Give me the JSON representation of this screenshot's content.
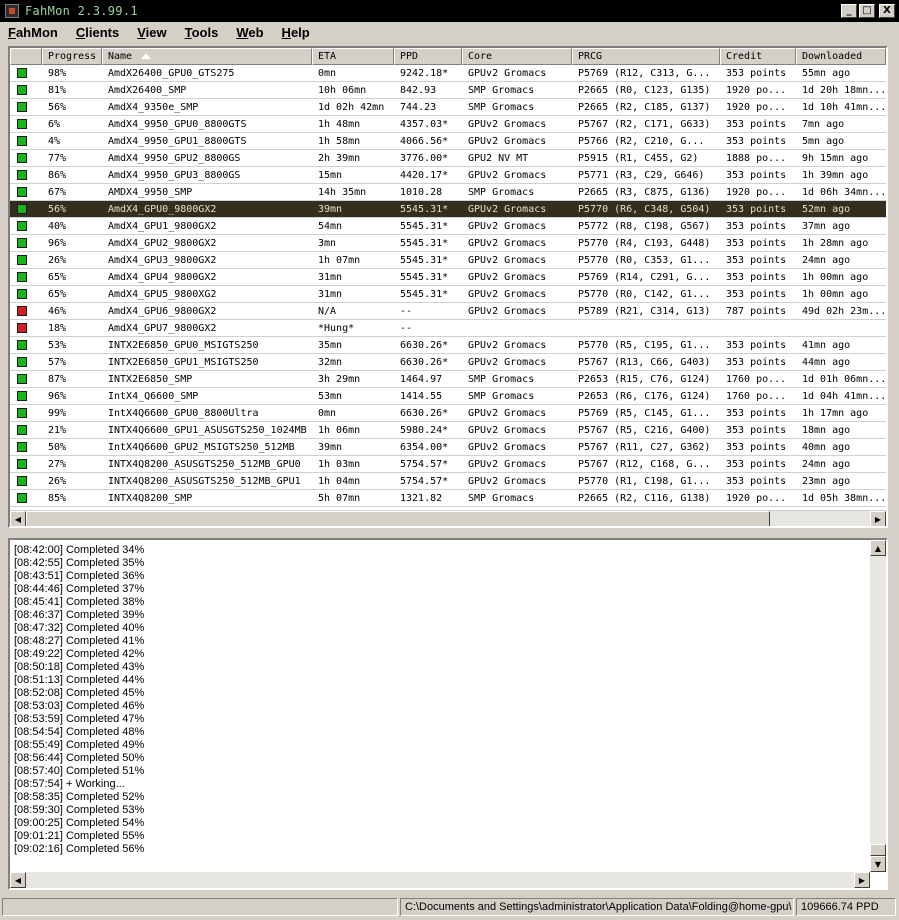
{
  "window": {
    "title": "FahMon 2.3.99.1"
  },
  "window_controls": {
    "minimize": "_",
    "maximize": "□",
    "close": "X"
  },
  "menu": {
    "fahmon": {
      "u": "F",
      "rest": "ahMon"
    },
    "clients": {
      "u": "C",
      "rest": "lients"
    },
    "view": {
      "u": "V",
      "rest": "iew"
    },
    "tools": {
      "u": "T",
      "rest": "ools"
    },
    "web": {
      "u": "W",
      "rest": "eb"
    },
    "help": {
      "u": "H",
      "rest": "elp"
    }
  },
  "columns": {
    "progress": "Progress",
    "name": "Name",
    "eta": "ETA",
    "ppd": "PPD",
    "core": "Core",
    "prcg": "PRCG",
    "credit": "Credit",
    "downloaded": "Downloaded"
  },
  "colors": {
    "ok": "#18b418",
    "stopped": "#d42020",
    "selected_bg": "#332e1e"
  },
  "rows": [
    {
      "status": "ok",
      "progress": "98%",
      "name": "AmdX26400_GPU0_GTS275",
      "eta": "0mn",
      "ppd": "9242.18*",
      "core": "GPUv2 Gromacs",
      "prcg": "P5769 (R12, C313, G...",
      "credit": "353 points",
      "downloaded": "55mn ago"
    },
    {
      "status": "ok",
      "progress": "81%",
      "name": "AmdX26400_SMP",
      "eta": "10h 06mn",
      "ppd": "842.93",
      "core": "SMP Gromacs",
      "prcg": "P2665 (R0, C123, G135)",
      "credit": "1920 po...",
      "downloaded": "1d 20h 18mn..."
    },
    {
      "status": "ok",
      "progress": "56%",
      "name": "AmdX4_9350e_SMP",
      "eta": "1d 02h 42mn",
      "ppd": "744.23",
      "core": "SMP Gromacs",
      "prcg": "P2665 (R2, C185, G137)",
      "credit": "1920 po...",
      "downloaded": "1d 10h 41mn..."
    },
    {
      "status": "ok",
      "progress": "6%",
      "name": "AmdX4_9950_GPU0_8800GTS",
      "eta": "1h 48mn",
      "ppd": "4357.03*",
      "core": "GPUv2 Gromacs",
      "prcg": "P5767 (R2, C171, G633)",
      "credit": "353 points",
      "downloaded": "7mn ago"
    },
    {
      "status": "ok",
      "progress": "4%",
      "name": "AmdX4_9950_GPU1_8800GTS",
      "eta": "1h 58mn",
      "ppd": "4066.56*",
      "core": "GPUv2 Gromacs",
      "prcg": "P5766 (R2, C210, G...",
      "credit": "353 points",
      "downloaded": "5mn ago"
    },
    {
      "status": "ok",
      "progress": "77%",
      "name": "AmdX4_9950_GPU2_8800GS",
      "eta": "2h 39mn",
      "ppd": "3776.00*",
      "core": "GPU2 NV MT",
      "prcg": "P5915 (R1, C455, G2)",
      "credit": "1888 po...",
      "downloaded": "9h 15mn ago"
    },
    {
      "status": "ok",
      "progress": "86%",
      "name": "AmdX4_9950_GPU3_8800GS",
      "eta": "15mn",
      "ppd": "4420.17*",
      "core": "GPUv2 Gromacs",
      "prcg": "P5771 (R3, C29, G646)",
      "credit": "353 points",
      "downloaded": "1h 39mn ago"
    },
    {
      "status": "ok",
      "progress": "67%",
      "name": "AMDX4_9950_SMP",
      "eta": "14h 35mn",
      "ppd": "1010.28",
      "core": "SMP Gromacs",
      "prcg": "P2665 (R3, C875, G136)",
      "credit": "1920 po...",
      "downloaded": "1d 06h 34mn..."
    },
    {
      "status": "ok",
      "selected": true,
      "progress": "56%",
      "name": "AmdX4_GPU0_9800GX2",
      "eta": "39mn",
      "ppd": "5545.31*",
      "core": "GPUv2 Gromacs",
      "prcg": "P5770 (R6, C348, G504)",
      "credit": "353 points",
      "downloaded": "52mn ago"
    },
    {
      "status": "ok",
      "progress": "40%",
      "name": "AmdX4_GPU1_9800GX2",
      "eta": "54mn",
      "ppd": "5545.31*",
      "core": "GPUv2 Gromacs",
      "prcg": "P5772 (R8, C198, G567)",
      "credit": "353 points",
      "downloaded": "37mn ago"
    },
    {
      "status": "ok",
      "progress": "96%",
      "name": "AmdX4_GPU2_9800GX2",
      "eta": "3mn",
      "ppd": "5545.31*",
      "core": "GPUv2 Gromacs",
      "prcg": "P5770 (R4, C193, G448)",
      "credit": "353 points",
      "downloaded": "1h 28mn ago"
    },
    {
      "status": "ok",
      "progress": "26%",
      "name": "AmdX4_GPU3_9800GX2",
      "eta": "1h 07mn",
      "ppd": "5545.31*",
      "core": "GPUv2 Gromacs",
      "prcg": "P5770 (R0, C353, G1...",
      "credit": "353 points",
      "downloaded": "24mn ago"
    },
    {
      "status": "ok",
      "progress": "65%",
      "name": "AmdX4_GPU4_9800GX2",
      "eta": "31mn",
      "ppd": "5545.31*",
      "core": "GPUv2 Gromacs",
      "prcg": "P5769 (R14, C291, G...",
      "credit": "353 points",
      "downloaded": "1h 00mn ago"
    },
    {
      "status": "ok",
      "progress": "65%",
      "name": "AmdX4_GPU5_9800XG2",
      "eta": "31mn",
      "ppd": "5545.31*",
      "core": "GPUv2 Gromacs",
      "prcg": "P5770 (R0, C142, G1...",
      "credit": "353 points",
      "downloaded": "1h 00mn ago"
    },
    {
      "status": "stopped",
      "progress": "46%",
      "name": "AmdX4_GPU6_9800GX2",
      "eta": "N/A",
      "ppd": "--",
      "core": "GPUv2 Gromacs",
      "prcg": "P5789 (R21, C314, G13)",
      "credit": "787 points",
      "downloaded": "49d 02h 23m..."
    },
    {
      "status": "stopped",
      "progress": "18%",
      "name": "AmdX4_GPU7_9800GX2",
      "eta": "*Hung*",
      "ppd": "--",
      "core": "",
      "prcg": "",
      "credit": "",
      "downloaded": ""
    },
    {
      "status": "ok",
      "progress": "53%",
      "name": "INTX2E6850_GPU0_MSIGTS250",
      "eta": "35mn",
      "ppd": "6630.26*",
      "core": "GPUv2 Gromacs",
      "prcg": "P5770 (R5, C195, G1...",
      "credit": "353 points",
      "downloaded": "41mn ago"
    },
    {
      "status": "ok",
      "progress": "57%",
      "name": "INTX2E6850_GPU1_MSIGTS250",
      "eta": "32mn",
      "ppd": "6630.26*",
      "core": "GPUv2 Gromacs",
      "prcg": "P5767 (R13, C66, G403)",
      "credit": "353 points",
      "downloaded": "44mn ago"
    },
    {
      "status": "ok",
      "progress": "87%",
      "name": "INTX2E6850_SMP",
      "eta": "3h 29mn",
      "ppd": "1464.97",
      "core": "SMP Gromacs",
      "prcg": "P2653 (R15, C76, G124)",
      "credit": "1760 po...",
      "downloaded": "1d 01h 06mn..."
    },
    {
      "status": "ok",
      "progress": "96%",
      "name": "IntX4_Q6600_SMP",
      "eta": "53mn",
      "ppd": "1414.55",
      "core": "SMP Gromacs",
      "prcg": "P2653 (R6, C176, G124)",
      "credit": "1760 po...",
      "downloaded": "1d 04h 41mn..."
    },
    {
      "status": "ok",
      "progress": "99%",
      "name": "IntX4Q6600_GPU0_8800Ultra",
      "eta": "0mn",
      "ppd": "6630.26*",
      "core": "GPUv2 Gromacs",
      "prcg": "P5769 (R5, C145, G1...",
      "credit": "353 points",
      "downloaded": "1h 17mn ago"
    },
    {
      "status": "ok",
      "progress": "21%",
      "name": "INTX4Q6600_GPU1_ASUSGTS250_1024MB",
      "eta": "1h 06mn",
      "ppd": "5980.24*",
      "core": "GPUv2 Gromacs",
      "prcg": "P5767 (R5, C216, G400)",
      "credit": "353 points",
      "downloaded": "18mn ago"
    },
    {
      "status": "ok",
      "progress": "50%",
      "name": "IntX4Q6600_GPU2_MSIGTS250_512MB",
      "eta": "39mn",
      "ppd": "6354.00*",
      "core": "GPUv2 Gromacs",
      "prcg": "P5767 (R11, C27, G362)",
      "credit": "353 points",
      "downloaded": "40mn ago"
    },
    {
      "status": "ok",
      "progress": "27%",
      "name": "INTX4Q8200_ASUSGTS250_512MB_GPU0",
      "eta": "1h 03mn",
      "ppd": "5754.57*",
      "core": "GPUv2 Gromacs",
      "prcg": "P5767 (R12, C168, G...",
      "credit": "353 points",
      "downloaded": "24mn ago"
    },
    {
      "status": "ok",
      "progress": "26%",
      "name": "INTX4Q8200_ASUSGTS250_512MB_GPU1",
      "eta": "1h 04mn",
      "ppd": "5754.57*",
      "core": "GPUv2 Gromacs",
      "prcg": "P5770 (R1, C198, G1...",
      "credit": "353 points",
      "downloaded": "23mn ago"
    },
    {
      "status": "ok",
      "progress": "85%",
      "name": "INTX4Q8200_SMP",
      "eta": "5h 07mn",
      "ppd": "1321.82",
      "core": "SMP Gromacs",
      "prcg": "P2665 (R2, C116, G138)",
      "credit": "1920 po...",
      "downloaded": "1d 05h 38mn..."
    }
  ],
  "log": [
    "[08:42:00] Completed 34%",
    "[08:42:55] Completed 35%",
    "[08:43:51] Completed 36%",
    "[08:44:46] Completed 37%",
    "[08:45:41] Completed 38%",
    "[08:46:37] Completed 39%",
    "[08:47:32] Completed 40%",
    "[08:48:27] Completed 41%",
    "[08:49:22] Completed 42%",
    "[08:50:18] Completed 43%",
    "[08:51:13] Completed 44%",
    "[08:52:08] Completed 45%",
    "[08:53:03] Completed 46%",
    "[08:53:59] Completed 47%",
    "[08:54:54] Completed 48%",
    "[08:55:49] Completed 49%",
    "[08:56:44] Completed 50%",
    "[08:57:40] Completed 51%",
    "[08:57:54] + Working...",
    "[08:58:35] Completed 52%",
    "[08:59:30] Completed 53%",
    "[09:00:25] Completed 54%",
    "[09:01:21] Completed 55%",
    "[09:02:16] Completed 56%"
  ],
  "statusbar": {
    "path": "C:\\Documents and Settings\\administrator\\Application Data\\Folding@home-gpu\\",
    "total_ppd": "109666.74 PPD"
  }
}
